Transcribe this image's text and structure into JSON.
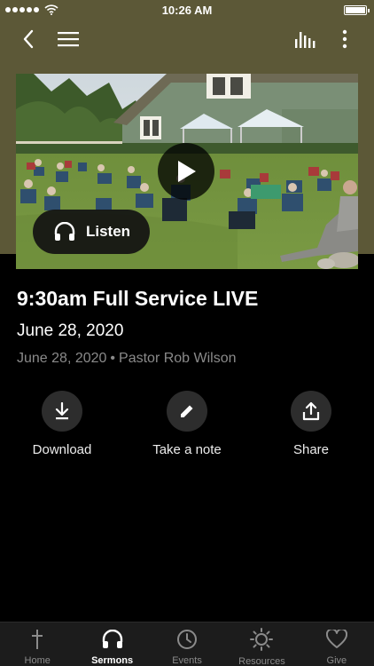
{
  "status_bar": {
    "time": "10:26 AM"
  },
  "nav": {
    "back_icon": "chevron-left-icon",
    "menu_icon": "hamburger-menu-icon",
    "audio_icon": "audio-bars-icon",
    "more_icon": "more-vertical-icon"
  },
  "media": {
    "image": "outdoor-service-photo",
    "play_icon": "play-icon",
    "listen_label": "Listen"
  },
  "sermon": {
    "title": "9:30am Full Service LIVE",
    "date": "June 28, 2020",
    "meta_date": "June 28, 2020",
    "separator": "•",
    "speaker": "Pastor Rob Wilson"
  },
  "actions": [
    {
      "label": "Download",
      "icon": "download-icon"
    },
    {
      "label": "Take a note",
      "icon": "pencil-icon"
    },
    {
      "label": "Share",
      "icon": "share-icon"
    }
  ],
  "tabs": [
    {
      "label": "Home",
      "icon": "cross-icon",
      "active": false
    },
    {
      "label": "Sermons",
      "icon": "headphones-icon",
      "active": true
    },
    {
      "label": "Events",
      "icon": "clock-icon",
      "active": false
    },
    {
      "label": "Resources",
      "icon": "sun-icon",
      "active": false
    },
    {
      "label": "Give",
      "icon": "heart-icon",
      "active": false
    }
  ],
  "colors": {
    "header_bg": "#5c5837",
    "background": "#000000",
    "tabbar_bg": "#1c1c1c",
    "muted_text": "#8a8a8a",
    "action_circle": "#2d2d2d"
  }
}
